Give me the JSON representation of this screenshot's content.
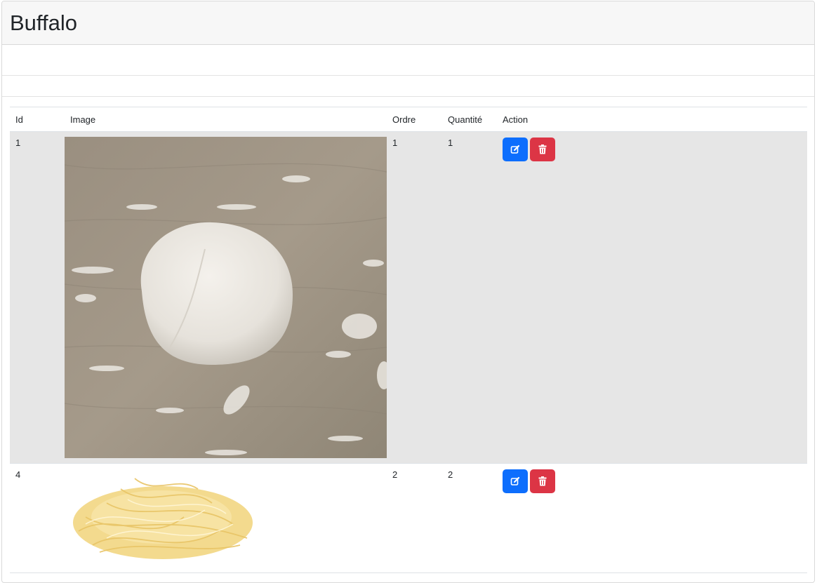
{
  "page": {
    "title": "Buffalo"
  },
  "table": {
    "headers": {
      "id": "Id",
      "image": "Image",
      "ordre": "Ordre",
      "quantite": "Quantité",
      "action": "Action"
    },
    "rows": [
      {
        "id": "1",
        "image": "dough-ball-photo",
        "ordre": "1",
        "quantite": "1",
        "edit_icon": "edit-icon",
        "delete_icon": "trash-icon"
      },
      {
        "id": "4",
        "image": "shredded-cheese-photo",
        "ordre": "2",
        "quantite": "2",
        "edit_icon": "edit-icon",
        "delete_icon": "trash-icon"
      }
    ]
  },
  "colors": {
    "edit_button": "#0d6efd",
    "delete_button": "#dc3545",
    "row_stripe": "#e6e6e6",
    "header_bg": "#f7f7f7"
  }
}
